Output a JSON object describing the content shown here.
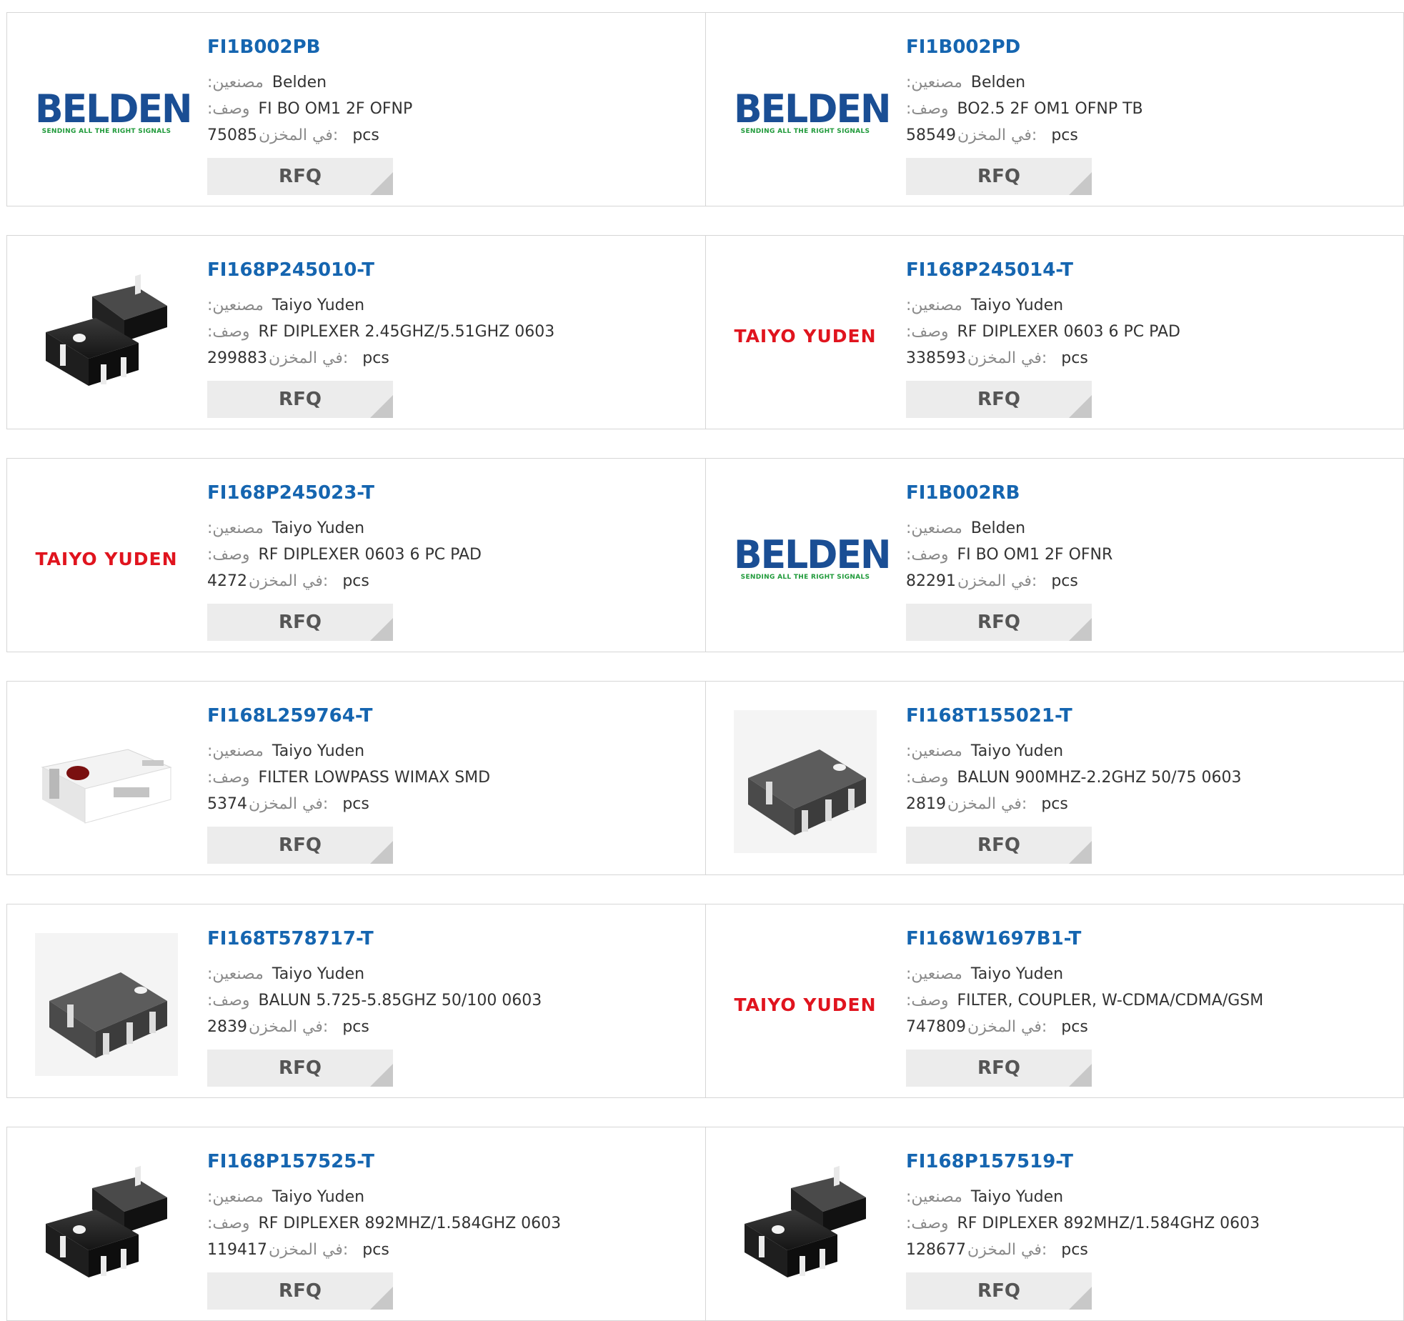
{
  "labels": {
    "manufacturer": ":مصنعين",
    "description": ":وصف",
    "stock": "في المخزن:",
    "unit": "pcs",
    "rfq": "RFQ"
  },
  "colors": {
    "link": "#1565b0",
    "belden_blue": "#1a4e94",
    "belden_green": "#1f9a3a",
    "taiyo_red": "#e0141e"
  },
  "logos": {
    "belden_word": "BELDEN",
    "belden_tagline": "SENDING ALL THE RIGHT SIGNALS",
    "taiyo": "TAIYO YUDEN"
  },
  "products": [
    {
      "part": "FI1B002PB",
      "manufacturer": "Belden",
      "description": "FI BO OM1 2F OFNP",
      "stock": "75085",
      "image": "belden-logo"
    },
    {
      "part": "FI1B002PD",
      "manufacturer": "Belden",
      "description": "BO2.5 2F OM1 OFNP TB",
      "stock": "58549",
      "image": "belden-logo"
    },
    {
      "part": "FI168P245010-T",
      "manufacturer": "Taiyo Yuden",
      "description": "RF DIPLEXER 2.45GHZ/5.51GHZ 0603",
      "stock": "299883",
      "image": "diplexer-chip-photo"
    },
    {
      "part": "FI168P245014-T",
      "manufacturer": "Taiyo Yuden",
      "description": "RF DIPLEXER 0603 6 PC PAD",
      "stock": "338593",
      "image": "taiyo-yuden-logo"
    },
    {
      "part": "FI168P245023-T",
      "manufacturer": "Taiyo Yuden",
      "description": "RF DIPLEXER 0603 6 PC PAD",
      "stock": "4272",
      "image": "taiyo-yuden-logo"
    },
    {
      "part": "FI1B002RB",
      "manufacturer": "Belden",
      "description": "FI BO OM1 2F OFNR",
      "stock": "82291",
      "image": "belden-logo"
    },
    {
      "part": "FI168L259764-T",
      "manufacturer": "Taiyo Yuden",
      "description": "FILTER LOWPASS WIMAX SMD",
      "stock": "5374",
      "image": "white-filter-chip-photo"
    },
    {
      "part": "FI168T155021-T",
      "manufacturer": "Taiyo Yuden",
      "description": "BALUN 900MHZ-2.2GHZ 50/75 0603",
      "stock": "2819",
      "image": "balun-chip-photo"
    },
    {
      "part": "FI168T578717-T",
      "manufacturer": "Taiyo Yuden",
      "description": "BALUN 5.725-5.85GHZ 50/100 0603",
      "stock": "2839",
      "image": "balun-chip-photo"
    },
    {
      "part": "FI168W1697B1-T",
      "manufacturer": "Taiyo Yuden",
      "description": "FILTER, COUPLER, W-CDMA/CDMA/GSM",
      "stock": "747809",
      "image": "taiyo-yuden-logo"
    },
    {
      "part": "FI168P157525-T",
      "manufacturer": "Taiyo Yuden",
      "description": "RF DIPLEXER 892MHZ/1.584GHZ 0603",
      "stock": "119417",
      "image": "diplexer-chip-photo"
    },
    {
      "part": "FI168P157519-T",
      "manufacturer": "Taiyo Yuden",
      "description": "RF DIPLEXER 892MHZ/1.584GHZ 0603",
      "stock": "128677",
      "image": "diplexer-chip-photo"
    }
  ]
}
